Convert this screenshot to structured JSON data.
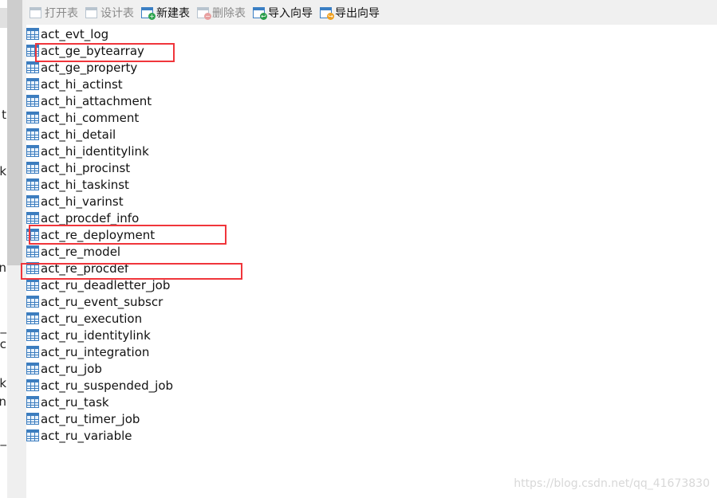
{
  "toolbar": {
    "items": [
      {
        "label": "打开表",
        "icon": "open-table-icon",
        "enabled": false
      },
      {
        "label": "设计表",
        "icon": "design-table-icon",
        "enabled": false
      },
      {
        "label": "新建表",
        "icon": "new-table-icon",
        "enabled": true
      },
      {
        "label": "删除表",
        "icon": "delete-table-icon",
        "enabled": false
      },
      {
        "label": "导入向导",
        "icon": "import-wizard-icon",
        "enabled": true
      },
      {
        "label": "导出向导",
        "icon": "export-wizard-icon",
        "enabled": true
      }
    ]
  },
  "left_fragments": [
    "t",
    "k",
    "n",
    "_",
    "sc",
    "k",
    "n",
    "d_"
  ],
  "tables": [
    "act_evt_log",
    "act_ge_bytearray",
    "act_ge_property",
    "act_hi_actinst",
    "act_hi_attachment",
    "act_hi_comment",
    "act_hi_detail",
    "act_hi_identitylink",
    "act_hi_procinst",
    "act_hi_taskinst",
    "act_hi_varinst",
    "act_procdef_info",
    "act_re_deployment",
    "act_re_model",
    "act_re_procdef",
    "act_ru_deadletter_job",
    "act_ru_event_subscr",
    "act_ru_execution",
    "act_ru_identitylink",
    "act_ru_integration",
    "act_ru_job",
    "act_ru_suspended_job",
    "act_ru_task",
    "act_ru_timer_job",
    "act_ru_variable"
  ],
  "highlighted": [
    "act_ge_bytearray",
    "act_re_deployment",
    "act_re_procdef"
  ],
  "highlight_color": "#f0353b",
  "watermark": "https://blog.csdn.net/qq_41673830"
}
